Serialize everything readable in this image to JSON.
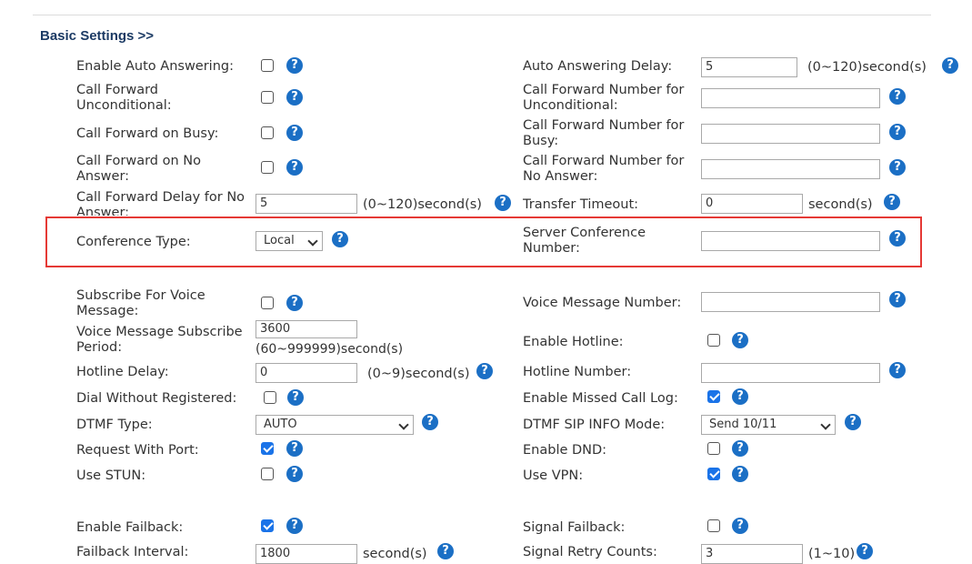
{
  "section": {
    "title": "Basic Settings >>"
  },
  "rows": {
    "auto_answer": {
      "label": "Enable Auto Answering:",
      "checked": false,
      "right_label": "Auto Answering Delay:",
      "right_value": "5",
      "right_unit": "(0~120)second(s)"
    },
    "cfu": {
      "label_1": "Call Forward",
      "label_2": "Unconditional:",
      "checked": false,
      "right_label_1": "Call Forward Number for",
      "right_label_2": "Unconditional:",
      "right_value": ""
    },
    "cfb": {
      "label": "Call Forward on Busy:",
      "checked": false,
      "right_label_1": "Call Forward Number for",
      "right_label_2": "Busy:",
      "right_value": ""
    },
    "cfna": {
      "label_1": "Call Forward on No",
      "label_2": "Answer:",
      "checked": false,
      "right_label_1": "Call Forward Number for",
      "right_label_2": "No Answer:",
      "right_value": ""
    },
    "cf_delay": {
      "label_1": "Call Forward Delay for No",
      "label_2": "Answer:",
      "value": "5",
      "unit": "(0~120)second(s)",
      "right_label": "Transfer Timeout:",
      "right_value": "0",
      "right_unit": "second(s)"
    },
    "conference": {
      "label": "Conference Type:",
      "value": "Local",
      "right_label_1": "Server Conference",
      "right_label_2": "Number:",
      "right_value": ""
    },
    "voice_sub": {
      "label_1": "Subscribe For Voice",
      "label_2": "Message:",
      "checked": false,
      "right_label": "Voice Message Number:",
      "right_value": ""
    },
    "vm_period": {
      "label_1": "Voice Message Subscribe",
      "label_2": "Period:",
      "value": "3600",
      "unit": "(60~999999)second(s)",
      "right_label": "Enable Hotline:",
      "right_checked": false
    },
    "hotline_delay": {
      "label": "Hotline Delay:",
      "value": "0",
      "unit": "(0~9)second(s)",
      "right_label": "Hotline Number:",
      "right_value": ""
    },
    "dial_wo_reg": {
      "label": "Dial Without Registered:",
      "checked": false,
      "right_label": "Enable Missed Call Log:",
      "right_checked": true
    },
    "dtmf": {
      "label": "DTMF Type:",
      "value": "AUTO",
      "right_label": "DTMF SIP INFO Mode:",
      "right_value": "Send 10/11"
    },
    "req_port": {
      "label": "Request With Port:",
      "checked": true,
      "right_label": "Enable DND:",
      "right_checked": false
    },
    "stun": {
      "label": "Use STUN:",
      "checked": false,
      "right_label": "Use VPN:",
      "right_checked": true
    },
    "failback": {
      "label": "Enable Failback:",
      "checked": true,
      "right_label": "Signal Failback:",
      "right_checked": false
    },
    "failback_interval": {
      "label": "Failback Interval:",
      "value": "1800",
      "unit": "second(s)",
      "right_label": "Signal Retry Counts:",
      "right_value": "3",
      "right_unit": "(1~10)"
    }
  },
  "icons": {
    "help": "?"
  },
  "colors": {
    "title": "#1b3a64",
    "help": "#1b6fc5",
    "checkbox_on": "#1a73e8",
    "highlight_border": "#e53935"
  }
}
